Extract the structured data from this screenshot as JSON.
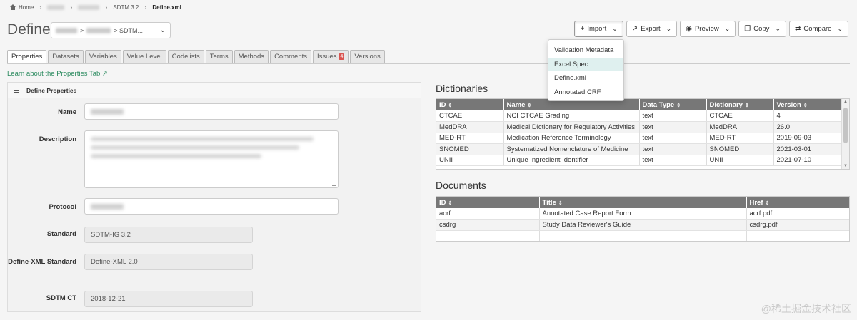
{
  "breadcrumb": {
    "home": "Home",
    "version": "SDTM 3.2",
    "current": "Define.xml"
  },
  "header": {
    "title": "Define:",
    "select_suffix": "> SDTM..."
  },
  "toolbar": {
    "import": "Import",
    "export": "Export",
    "preview": "Preview",
    "copy": "Copy",
    "compare": "Compare"
  },
  "import_menu": [
    "Validation Metadata",
    "Excel Spec",
    "Define.xml",
    "Annotated CRF"
  ],
  "tabs": [
    {
      "label": "Properties"
    },
    {
      "label": "Datasets"
    },
    {
      "label": "Variables"
    },
    {
      "label": "Value Level"
    },
    {
      "label": "Codelists"
    },
    {
      "label": "Terms"
    },
    {
      "label": "Methods"
    },
    {
      "label": "Comments"
    },
    {
      "label": "Issues",
      "badge": "4"
    },
    {
      "label": "Versions"
    }
  ],
  "learn_link": "Learn about the Properties Tab",
  "properties": {
    "panel_title": "Define Properties",
    "labels": {
      "name": "Name",
      "description": "Description",
      "protocol": "Protocol",
      "standard": "Standard",
      "define_xml_standard": "Define-XML Standard",
      "sdtm_ct": "SDTM CT"
    },
    "values": {
      "standard": "SDTM-IG 3.2",
      "define_xml_standard": "Define-XML 2.0",
      "sdtm_ct": "2018-12-21"
    }
  },
  "dictionaries": {
    "title": "Dictionaries",
    "columns": [
      "ID",
      "Name",
      "Data Type",
      "Dictionary",
      "Version"
    ],
    "rows": [
      [
        "CTCAE",
        "NCI CTCAE Grading",
        "text",
        "CTCAE",
        "4"
      ],
      [
        "MedDRA",
        "Medical Dictionary for Regulatory Activities",
        "text",
        "MedDRA",
        "26.0"
      ],
      [
        "MED-RT",
        "Medication Reference Terminology",
        "text",
        "MED-RT",
        "2019-09-03"
      ],
      [
        "SNOMED",
        "Systematized Nomenclature of Medicine",
        "text",
        "SNOMED",
        "2021-03-01"
      ],
      [
        "UNII",
        "Unique Ingredient Identifier",
        "text",
        "UNII",
        "2021-07-10"
      ]
    ]
  },
  "documents": {
    "title": "Documents",
    "columns": [
      "ID",
      "Title",
      "Href"
    ],
    "rows": [
      [
        "acrf",
        "Annotated Case Report Form",
        "acrf.pdf"
      ],
      [
        "csdrg",
        "Study Data Reviewer's Guide",
        "csdrg.pdf"
      ],
      [
        "",
        "",
        ""
      ]
    ]
  },
  "watermark": "@稀土掘金技术社区"
}
